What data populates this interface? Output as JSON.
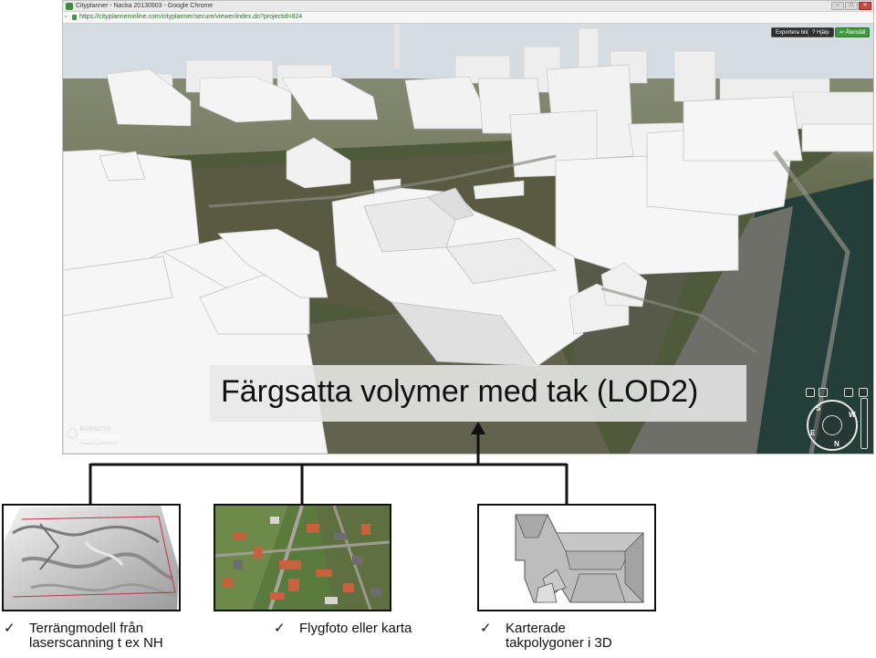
{
  "browser": {
    "window_title": "Cityplanner - Nacka 20130903 - Google Chrome",
    "url": "https://cityplanneronline.com/cityplanner/secure/viewer/index.do?projectid=824",
    "window_buttons": [
      "–",
      "□",
      "✕"
    ]
  },
  "viewer": {
    "toolbar": {
      "export_label": "Exportera bild",
      "help_label": "? Hjälp",
      "back_label": "↩ Återställ"
    },
    "logo": {
      "line1": "AGENCY9",
      "line2": "CityPlanner",
      "line3": "Powered by AGENCY9"
    },
    "compass_letters": [
      "S",
      "W",
      "N",
      "E"
    ],
    "caption": "Färgsatta volymer med tak (LOD2)"
  },
  "sources": [
    {
      "check": "✓",
      "line1": "Terrängmodell från",
      "line2": "laserscanning t ex NH"
    },
    {
      "check": "✓",
      "line1": "Flygfoto eller karta",
      "line2": ""
    },
    {
      "check": "✓",
      "line1": "Karterade",
      "line2": "takpolygoner i 3D"
    }
  ]
}
